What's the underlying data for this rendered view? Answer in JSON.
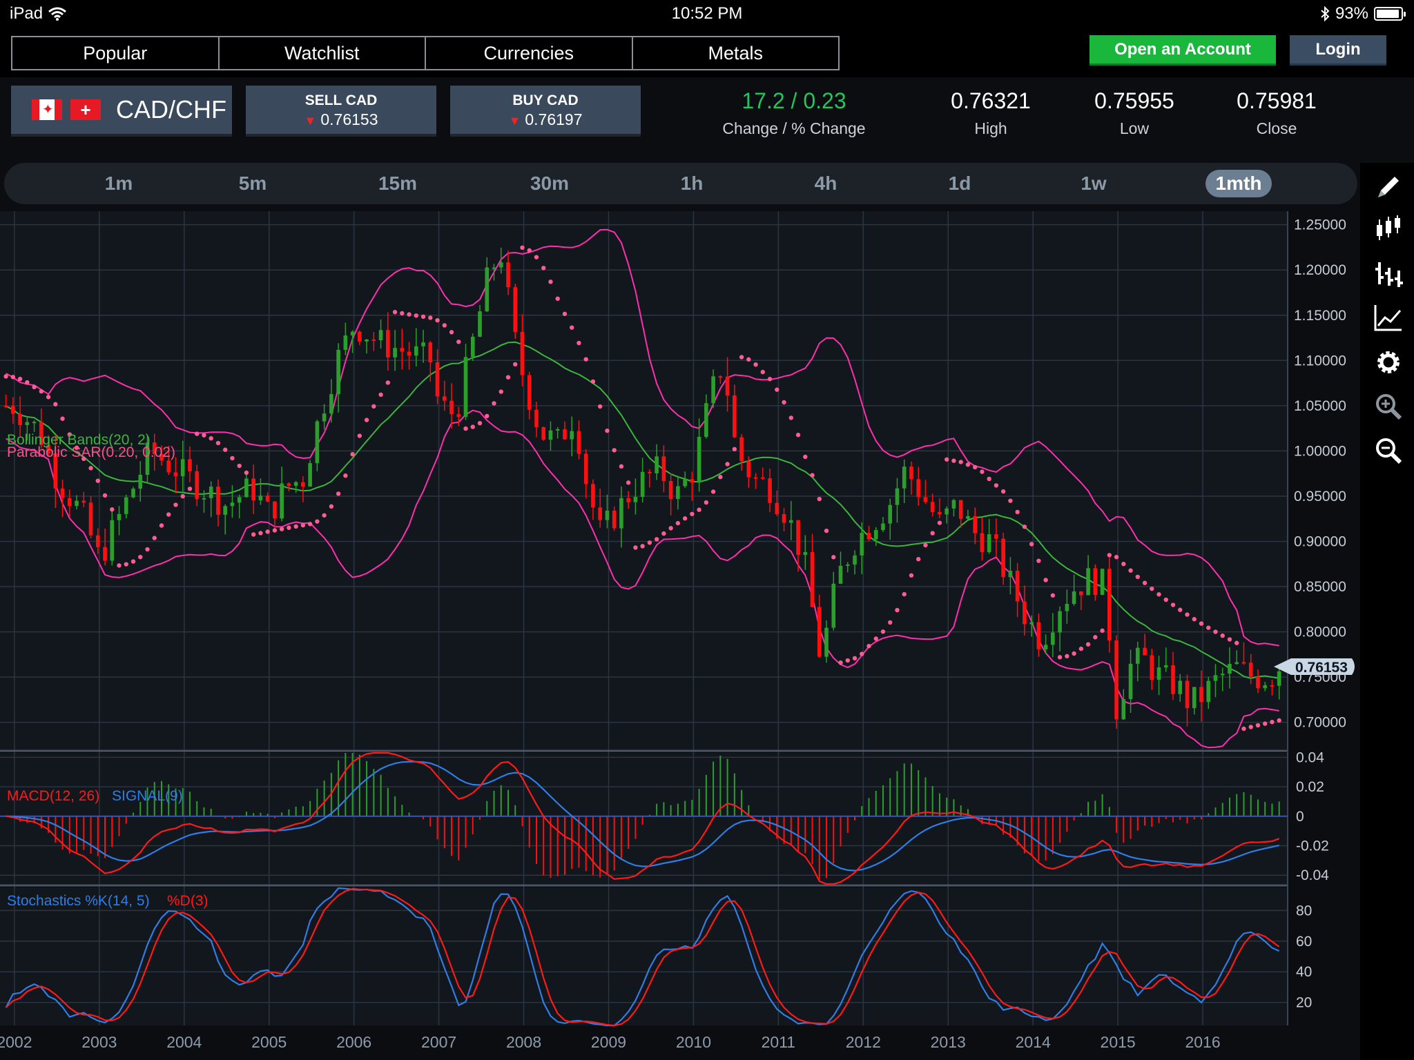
{
  "status_bar": {
    "device": "iPad",
    "time": "10:52 PM",
    "battery": "93%",
    "battery_level": 0.93
  },
  "nav": {
    "tabs": [
      "Popular",
      "Watchlist",
      "Currencies",
      "Metals"
    ],
    "active": 2
  },
  "account": {
    "open_label": "Open an Account",
    "login_label": "Login"
  },
  "quote": {
    "pair": "CAD/CHF",
    "sell": {
      "label": "SELL CAD",
      "price": "0.76153"
    },
    "buy": {
      "label": "BUY CAD",
      "price": "0.76197"
    },
    "change": {
      "value": "17.2 / 0.23",
      "label": "Change / % Change",
      "color": "#22c55e"
    },
    "high": {
      "value": "0.76321",
      "label": "High"
    },
    "low": {
      "value": "0.75955",
      "label": "Low"
    },
    "close": {
      "value": "0.75981",
      "label": "Close"
    }
  },
  "timeframes": {
    "items": [
      "1m",
      "5m",
      "15m",
      "30m",
      "1h",
      "4h",
      "1d",
      "1w",
      "1mth"
    ],
    "active": 8
  },
  "toolbar": {
    "icons": [
      "pencil-icon",
      "candlestick-icon",
      "bar-chart-icon",
      "line-chart-icon",
      "gear-icon",
      "zoom-in-icon",
      "zoom-out-icon"
    ]
  },
  "colors": {
    "up": "#2aa02a",
    "down": "#ff1010",
    "band": "#ff2fae",
    "mid": "#3cb53c",
    "sar": "#ff5c92",
    "macd": "#ff1a1a",
    "signal": "#2f7ee6",
    "grid": "#2c3542"
  },
  "chart_data": [
    {
      "type": "candlestick",
      "indicators": [
        "Bollinger Bands(20, 2)",
        "Parabolic SAR(0.20, 0.02)"
      ],
      "x_labels": [
        "2002",
        "2003",
        "2004",
        "2005",
        "2006",
        "2007",
        "2008",
        "2009",
        "2010",
        "2011",
        "2012",
        "2013",
        "2014",
        "2015",
        "2016"
      ],
      "y_ticks": [
        "1.25000",
        "1.20000",
        "1.15000",
        "1.10000",
        "1.05000",
        "1.00000",
        "0.95000",
        "0.90000",
        "0.85000",
        "0.80000",
        "0.75000",
        "0.70000"
      ],
      "ylim": [
        0.67,
        1.265
      ],
      "current_price": "0.76153",
      "price_path": [
        [
          2002.0,
          1.05
        ],
        [
          2002.3,
          1.02
        ],
        [
          2002.5,
          0.97
        ],
        [
          2002.8,
          0.93
        ],
        [
          2003.0,
          0.88
        ],
        [
          2003.3,
          0.94
        ],
        [
          2003.6,
          1.0
        ],
        [
          2003.9,
          0.98
        ],
        [
          2004.2,
          0.96
        ],
        [
          2004.5,
          0.94
        ],
        [
          2004.8,
          0.96
        ],
        [
          2005.0,
          0.93
        ],
        [
          2005.2,
          0.96
        ],
        [
          2005.4,
          0.97
        ],
        [
          2005.6,
          1.04
        ],
        [
          2005.8,
          1.1
        ],
        [
          2006.0,
          1.14
        ],
        [
          2006.3,
          1.12
        ],
        [
          2006.6,
          1.11
        ],
        [
          2006.9,
          1.1
        ],
        [
          2007.0,
          1.05
        ],
        [
          2007.2,
          1.04
        ],
        [
          2007.4,
          1.12
        ],
        [
          2007.6,
          1.2
        ],
        [
          2007.75,
          1.22
        ],
        [
          2007.85,
          1.14
        ],
        [
          2008.0,
          1.08
        ],
        [
          2008.2,
          1.02
        ],
        [
          2008.4,
          1.01
        ],
        [
          2008.6,
          1.04
        ],
        [
          2008.75,
          0.96
        ],
        [
          2008.9,
          0.91
        ],
        [
          2009.0,
          0.92
        ],
        [
          2009.3,
          0.96
        ],
        [
          2009.6,
          0.98
        ],
        [
          2009.8,
          0.95
        ],
        [
          2010.0,
          0.98
        ],
        [
          2010.2,
          1.06
        ],
        [
          2010.35,
          1.1
        ],
        [
          2010.5,
          1.0
        ],
        [
          2010.7,
          0.97
        ],
        [
          2010.9,
          0.96
        ],
        [
          2011.1,
          0.93
        ],
        [
          2011.3,
          0.88
        ],
        [
          2011.5,
          0.77
        ],
        [
          2011.7,
          0.86
        ],
        [
          2011.9,
          0.9
        ],
        [
          2012.1,
          0.92
        ],
        [
          2012.3,
          0.94
        ],
        [
          2012.5,
          0.98
        ],
        [
          2012.7,
          0.95
        ],
        [
          2012.9,
          0.92
        ],
        [
          2013.1,
          0.94
        ],
        [
          2013.3,
          0.91
        ],
        [
          2013.5,
          0.9
        ],
        [
          2013.7,
          0.86
        ],
        [
          2013.9,
          0.82
        ],
        [
          2014.1,
          0.79
        ],
        [
          2014.3,
          0.83
        ],
        [
          2014.5,
          0.85
        ],
        [
          2014.7,
          0.86
        ],
        [
          2014.85,
          0.85
        ],
        [
          2015.0,
          0.7
        ],
        [
          2015.1,
          0.76
        ],
        [
          2015.3,
          0.77
        ],
        [
          2015.5,
          0.75
        ],
        [
          2015.7,
          0.74
        ],
        [
          2015.85,
          0.72
        ],
        [
          2016.0,
          0.73
        ],
        [
          2016.2,
          0.75
        ],
        [
          2016.4,
          0.76
        ],
        [
          2016.6,
          0.75
        ],
        [
          2016.8,
          0.75
        ],
        [
          2016.9,
          0.762
        ]
      ]
    },
    {
      "type": "line",
      "title": "MACD(12, 26)",
      "series": [
        {
          "name": "MACD(12, 26)"
        },
        {
          "name": "SIGNAL(9)"
        }
      ],
      "y_ticks": [
        "0.04",
        "0.02",
        "0",
        "-0.02",
        "-0.04"
      ],
      "ylim": [
        -0.046,
        0.043
      ]
    },
    {
      "type": "line",
      "title": "Stochastics %K(14, 5) %D(3)",
      "series": [
        {
          "name": "%K(14, 5)"
        },
        {
          "name": "%D(3)"
        }
      ],
      "y_ticks": [
        "80",
        "60",
        "40",
        "20"
      ],
      "ylim": [
        5,
        95
      ]
    }
  ]
}
